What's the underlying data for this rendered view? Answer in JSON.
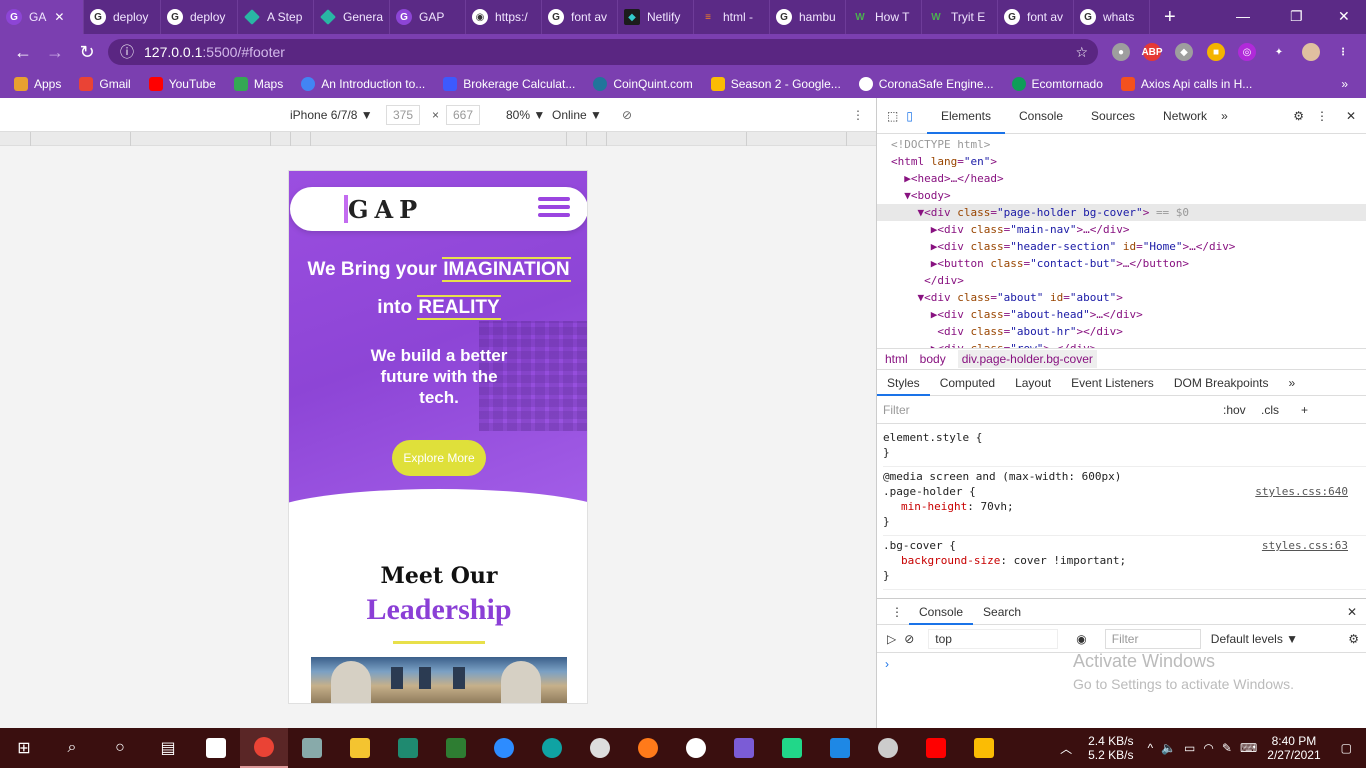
{
  "tabs": [
    {
      "label": "GA",
      "icon": "gap-favicon"
    },
    {
      "label": "deploy",
      "icon": "google-icon"
    },
    {
      "label": "deploy",
      "icon": "google-icon"
    },
    {
      "label": "A Step",
      "icon": "diamond-icon"
    },
    {
      "label": "Genera",
      "icon": "diamond-icon"
    },
    {
      "label": "GAP",
      "icon": "gap-favicon"
    },
    {
      "label": "https:/",
      "icon": "globe-icon"
    },
    {
      "label": "font av",
      "icon": "google-icon"
    },
    {
      "label": "Netlify",
      "icon": "netlify-icon"
    },
    {
      "label": "html -",
      "icon": "stackoverflow-icon"
    },
    {
      "label": "hambu",
      "icon": "google-icon"
    },
    {
      "label": "How T",
      "icon": "w-icon"
    },
    {
      "label": "Tryit E",
      "icon": "w-icon"
    },
    {
      "label": "font av",
      "icon": "google-icon"
    },
    {
      "label": "whats",
      "icon": "google-icon"
    }
  ],
  "address": {
    "host": "127.0.0.1",
    "path": ":5500/#footer"
  },
  "bookmarks": [
    {
      "label": "Apps",
      "color": "#e8a030"
    },
    {
      "label": "Gmail",
      "color": "#ea4335"
    },
    {
      "label": "YouTube",
      "color": "#ff0000"
    },
    {
      "label": "Maps",
      "color": "#34a853"
    },
    {
      "label": "An Introduction to...",
      "color": "#4285f4"
    },
    {
      "label": "Brokerage Calculat...",
      "color": "#3d5afe"
    },
    {
      "label": "CoinQuint.com",
      "color": "#21759b"
    },
    {
      "label": "Season 2 - Google...",
      "color": "#fbbc04"
    },
    {
      "label": "CoronaSafe Engine...",
      "color": "#ffffff"
    },
    {
      "label": "Ecomtornado",
      "color": "#0f9d58"
    },
    {
      "label": "Axios Api calls in H...",
      "color": "#f4511e"
    }
  ],
  "device_toolbar": {
    "device": "iPhone 6/7/8 ▼",
    "width": "375",
    "height": "667",
    "zoom": "80% ▼",
    "network": "Online ▼",
    "x": "×"
  },
  "site": {
    "logo": "GAP",
    "headline1_pre": "We Bring your ",
    "headline1_hl": "IMAGINATION",
    "headline2_pre": "into ",
    "headline2_hl": "REALITY",
    "subtitle": "We build a better future with the tech.",
    "cta": "Explore More",
    "meet": "Meet  Our",
    "leadership": "Leadership"
  },
  "devtools": {
    "tabs": [
      "Elements",
      "Console",
      "Sources",
      "Network"
    ],
    "crumbs": [
      "html",
      "body",
      "div.page-holder.bg-cover"
    ],
    "style_tabs": [
      "Styles",
      "Computed",
      "Layout",
      "Event Listeners",
      "DOM Breakpoints"
    ],
    "filter": "Filter",
    "hov": ":hov",
    "cls": ".cls",
    "rule1": "element.style {",
    "rule1_end": "}",
    "media": "@media screen and (max-width: 600px)",
    "sel2": ".page-holder {",
    "prop2": "min-height",
    "val2": ": 70vh;",
    "src2": "styles.css:640",
    "sel3": ".bg-cover {",
    "prop3": "background-size",
    "val3": ": cover !important;",
    "src3": "styles.css:63",
    "console_tabs": [
      "Console",
      "Search"
    ],
    "context": "top",
    "cfilter": "Filter",
    "levels": "Default levels ▼",
    "wm1": "Activate Windows",
    "wm2": "Go to Settings to activate Windows."
  },
  "tray": {
    "net_up": "2.4 KB/s",
    "net_down": "5.2 KB/s",
    "time": "8:40 PM",
    "date": "2/27/2021"
  }
}
